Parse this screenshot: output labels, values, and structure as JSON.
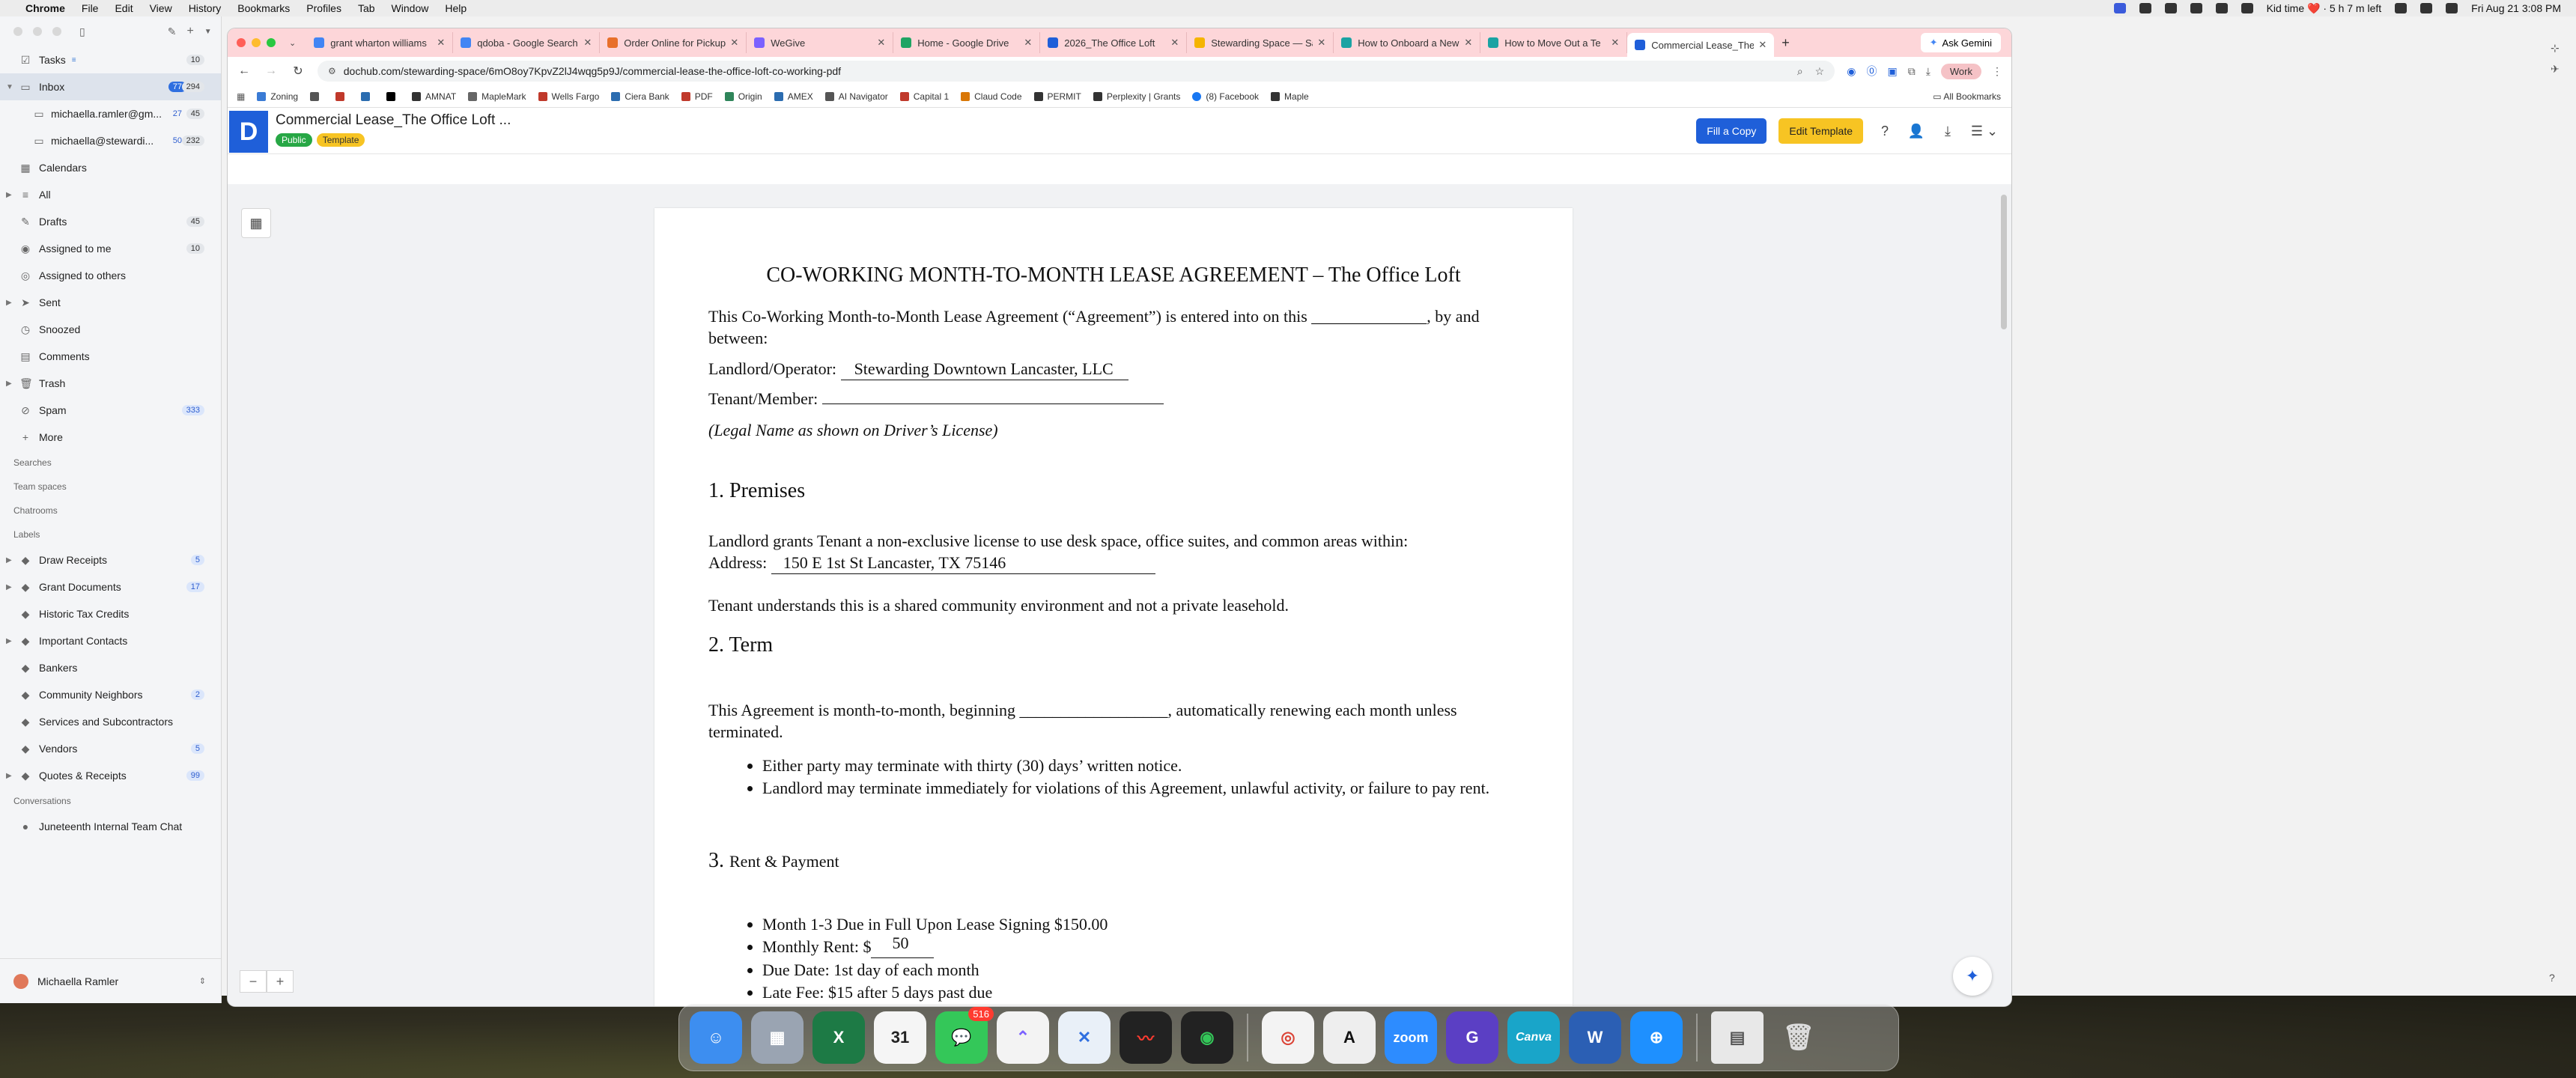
{
  "menubar": {
    "app": "Chrome",
    "items": [
      "File",
      "Edit",
      "View",
      "History",
      "Bookmarks",
      "Profiles",
      "Tab",
      "Window",
      "Help"
    ],
    "status_text": "Kid time ❤️ · 5 h 7 m left",
    "clock": "Fri Aug 21  3:08 PM"
  },
  "sidebar": {
    "items": [
      {
        "label": "Tasks",
        "count": "10",
        "icon": "☑"
      },
      {
        "label": "Inbox",
        "count_unread": "77",
        "count": "294",
        "icon": "▭",
        "selected": true
      },
      {
        "label": "michaella.ramler@gm...",
        "count": "45",
        "count_unread": "27",
        "sub": true,
        "icon": "▭"
      },
      {
        "label": "michaella@stewardi...",
        "count": "232",
        "count_unread": "50",
        "sub": true,
        "icon": "▭"
      },
      {
        "label": "Calendars",
        "icon": "▦"
      },
      {
        "label": "All",
        "icon": "≡"
      },
      {
        "label": "Drafts",
        "count": "45",
        "icon": "✎"
      },
      {
        "label": "Assigned to me",
        "count": "10",
        "icon": "◉"
      },
      {
        "label": "Assigned to others",
        "icon": "◎"
      },
      {
        "label": "Sent",
        "icon": "➤"
      },
      {
        "label": "Snoozed",
        "icon": "◷"
      },
      {
        "label": "Comments",
        "icon": "▤"
      },
      {
        "label": "Trash",
        "icon": "🗑"
      },
      {
        "label": "Spam",
        "count": "333",
        "icon": "⊘"
      },
      {
        "label": "More",
        "icon": "+"
      }
    ],
    "sections": [
      "Searches",
      "Team spaces",
      "Chatrooms",
      "Labels"
    ],
    "labels": [
      {
        "label": "Draw Receipts",
        "count": "5"
      },
      {
        "label": "Grant Documents",
        "count": "17"
      },
      {
        "label": "Historic Tax Credits"
      },
      {
        "label": "Important Contacts"
      },
      {
        "label": "Bankers"
      },
      {
        "label": "Community Neighbors",
        "count": "2"
      },
      {
        "label": "Services and Subcontractors"
      },
      {
        "label": "Vendors",
        "count": "5"
      },
      {
        "label": "Quotes & Receipts",
        "count": "99"
      }
    ],
    "conversations_section": "Conversations",
    "conversations": [
      {
        "label": "Juneteenth Internal Team Chat"
      }
    ],
    "user": "Michaella Ramler"
  },
  "chrome": {
    "tabs": [
      {
        "title": "grant wharton williams",
        "color": "#4285f4"
      },
      {
        "title": "qdoba - Google Search",
        "color": "#4285f4"
      },
      {
        "title": "Order Online for Pickup",
        "color": "#e8702a"
      },
      {
        "title": "WeGive",
        "color": "#7b61ff"
      },
      {
        "title": "Home - Google Drive",
        "color": "#1fa463"
      },
      {
        "title": "2026_The Office Loft",
        "color": "#1f5fd9"
      },
      {
        "title": "Stewarding Space — Sa",
        "color": "#f5b400"
      },
      {
        "title": "How to Onboard a New",
        "color": "#1aa3a3"
      },
      {
        "title": "How to Move Out a Te",
        "color": "#1aa3a3"
      },
      {
        "title": "Commercial Lease_The",
        "color": "#1f5fd9",
        "active": true
      }
    ],
    "ask_gemini": "Ask Gemini",
    "url": "dochub.com/stewarding-space/6mO8oy7KpvZ2lJ4wqg5p9J/commercial-lease-the-office-loft-co-working-pdf",
    "profile": "Work",
    "bookmarks": [
      {
        "label": "Zoning",
        "color": "#3a7bd5"
      },
      {
        "label": "",
        "color": "#555"
      },
      {
        "label": "",
        "color": "#c0392b"
      },
      {
        "label": "",
        "color": "#2b6cb0"
      },
      {
        "label": "",
        "color": "#000"
      },
      {
        "label": "AMNAT",
        "color": "#333"
      },
      {
        "label": "MapleMark",
        "color": "#666"
      },
      {
        "label": "Wells Fargo",
        "color": "#c0392b"
      },
      {
        "label": "Ciera Bank",
        "color": "#2b6cb0"
      },
      {
        "label": "PDF",
        "color": "#c0392b"
      },
      {
        "label": "Origin",
        "color": "#2f855a"
      },
      {
        "label": "AMEX",
        "color": "#2b6cb0"
      },
      {
        "label": "AI Navigator",
        "color": "#555"
      },
      {
        "label": "Capital 1",
        "color": "#c0392b"
      },
      {
        "label": "Claud Code",
        "color": "#d97706"
      },
      {
        "label": "PERMIT",
        "color": "#333"
      },
      {
        "label": "Perplexity | Grants",
        "color": "#333"
      },
      {
        "label": "(8) Facebook",
        "color": "#1877f2"
      },
      {
        "label": "Maple",
        "color": "#333"
      }
    ],
    "all_bookmarks": "All Bookmarks"
  },
  "dochub": {
    "doc_title": "Commercial Lease_The Office Loft ...",
    "badge_public": "Public",
    "badge_template": "Template",
    "fill_copy": "Fill a Copy",
    "edit_template": "Edit Template"
  },
  "document": {
    "title": "CO-WORKING MONTH-TO-MONTH LEASE AGREEMENT – The Office Loft",
    "intro": "This Co-Working Month-to-Month Lease Agreement (“Agreement”) is entered into on this ______________, by and between:",
    "landlord_label": "Landlord/Operator:",
    "landlord_value": "Stewarding Downtown Lancaster, LLC",
    "tenant_label": "Tenant/Member:",
    "legal_name_note": "(Legal Name as shown on Driver’s License)",
    "s1_num": "1.",
    "s1_title": "Premises",
    "s1_text": "Landlord grants Tenant a non-exclusive license to use desk space, office suites, and common areas within:",
    "address_label": "Address:",
    "address_value": "150 E 1st St Lancaster, TX 75146",
    "s1_note": "Tenant understands this is a shared community environment and not a private leasehold.",
    "s2_num": "2.",
    "s2_title": "Term",
    "s2_text": "This Agreement is month-to-month, beginning __________________, automatically renewing each month unless terminated.",
    "s2_bullets": [
      "Either party may terminate with thirty (30) days’ written notice.",
      "Landlord may terminate immediately for violations of this Agreement, unlawful activity, or failure to pay rent."
    ],
    "s3_num": "3.",
    "s3_title": "Rent & Payment",
    "s3_b1": "Month 1-3 Due in Full Upon Lease Signing $150.00",
    "s3_rent_label": "Monthly Rent: $",
    "s3_rent_value": "50",
    "s3_b3": "Due Date: 1st day of each month",
    "s3_b4": "Late Fee: $15 after 5 days past due"
  },
  "dock": {
    "apps": [
      {
        "name": "Finder",
        "color": "#3d8ef0"
      },
      {
        "name": "Launchpad",
        "color": "#9aa4b2"
      },
      {
        "name": "Excel",
        "color": "#1d7a45"
      },
      {
        "name": "Calendar",
        "color": "#f5f5f5",
        "text": "31"
      },
      {
        "name": "Messages",
        "color": "#34c759",
        "badge": "516"
      },
      {
        "name": "ClickUp",
        "color": "#f3f3f3"
      },
      {
        "name": "Spark",
        "color": "#e9f0f8"
      },
      {
        "name": "Voice Memos",
        "color": "#222"
      },
      {
        "name": "Siri",
        "color": "#222"
      },
      {
        "name": "Chrome",
        "color": "#f3f3f3"
      },
      {
        "name": "Anthropic",
        "color": "#eee"
      },
      {
        "name": "Zoom",
        "color": "#2d8cff",
        "text": "zoom"
      },
      {
        "name": "Grammarly",
        "color": "#5b3fc4"
      },
      {
        "name": "Canva",
        "color": "#19a5c9",
        "text": "Canva"
      },
      {
        "name": "Word",
        "color": "#2b5fb4",
        "text": "W"
      },
      {
        "name": "Safari",
        "color": "#1e90ff"
      }
    ]
  }
}
